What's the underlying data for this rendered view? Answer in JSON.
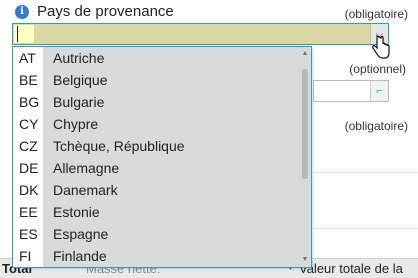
{
  "field": {
    "label": "Pays de provenance",
    "required_label": "(obligatoire)",
    "value": ""
  },
  "field2": {
    "optional_label": "(optionnel)"
  },
  "field3": {
    "required_label": "(obligatoire)"
  },
  "bottom": {
    "left": "Total",
    "middle": "Masse nette:",
    "right": "Valeur totale de la"
  },
  "options": [
    {
      "code": "AT",
      "name": "Autriche"
    },
    {
      "code": "BE",
      "name": "Belgique"
    },
    {
      "code": "BG",
      "name": "Bulgarie"
    },
    {
      "code": "CY",
      "name": "Chypre"
    },
    {
      "code": "CZ",
      "name": "Tchèque, République"
    },
    {
      "code": "DE",
      "name": "Allemagne"
    },
    {
      "code": "DK",
      "name": "Danemark"
    },
    {
      "code": "EE",
      "name": "Estonie"
    },
    {
      "code": "ES",
      "name": "Espagne"
    },
    {
      "code": "FI",
      "name": "Finlande"
    }
  ],
  "icons": {
    "info": "info-icon",
    "dropdown": "chevron-down-icon",
    "pointer": "hand-pointer-icon",
    "field2_button": "corner-arrow-icon"
  },
  "colors": {
    "accent_border": "#2aa2b5",
    "combo_fill": "#dcd8a4",
    "input_highlight": "#ffffc2",
    "info_blue": "#2f7bd6"
  }
}
